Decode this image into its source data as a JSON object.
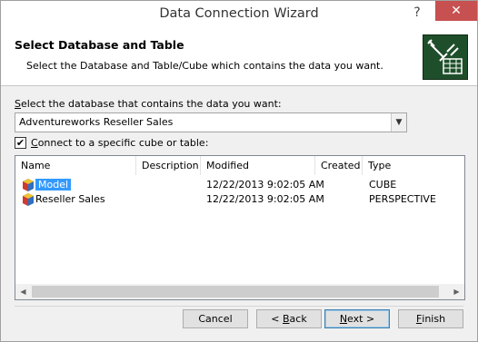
{
  "window": {
    "title": "Data Connection Wizard",
    "help_glyph": "?",
    "close_glyph": "✕"
  },
  "header": {
    "title": "Select Database and Table",
    "subtitle": "Select the Database and Table/Cube which contains the data you want."
  },
  "database": {
    "label_mnemonic": "S",
    "label_rest": "elect the database that contains the data you want:",
    "selected": "Adventureworks Reseller Sales"
  },
  "connect_checkbox": {
    "checked": true,
    "mnemonic": "C",
    "label_rest": "onnect to a specific cube or table:"
  },
  "grid": {
    "columns": [
      "Name",
      "Description",
      "Modified",
      "Created",
      "Type"
    ],
    "rows": [
      {
        "name": "Model",
        "description": "",
        "modified": "12/22/2013 9:02:05 AM",
        "created": "",
        "type": "CUBE",
        "selected": true,
        "icon": "cube-icon"
      },
      {
        "name": "Reseller Sales",
        "description": "",
        "modified": "12/22/2013 9:02:05 AM",
        "created": "",
        "type": "PERSPECTIVE",
        "selected": false,
        "icon": "perspective-cube-icon"
      }
    ]
  },
  "buttons": {
    "cancel": "Cancel",
    "back_prefix": "< ",
    "back_mnemonic": "B",
    "back_rest": "ack",
    "next_mnemonic": "N",
    "next_rest": "ext >",
    "finish_mnemonic": "F",
    "finish_rest": "inish"
  },
  "colors": {
    "accent": "#3399ff",
    "header_icon_bg": "#1e4f2a",
    "close_button": "#c75050"
  }
}
